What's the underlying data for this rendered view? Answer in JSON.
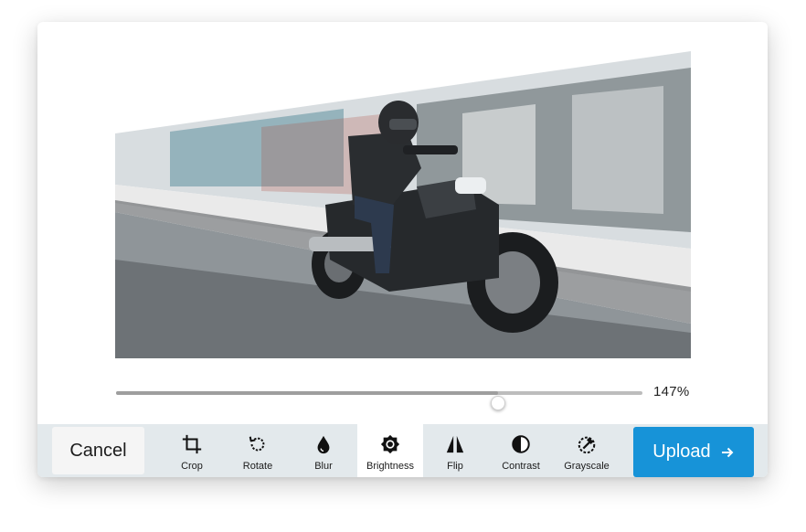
{
  "image": {
    "alt_hint": "motorcycle rider photo"
  },
  "zoom": {
    "value_text": "147%",
    "slider_fraction": 0.725
  },
  "toolbar": {
    "cancel_label": "Cancel",
    "upload_label": "Upload",
    "upload_icon": "arrow-right-icon",
    "accent_color": "#1793d8",
    "tools": [
      {
        "label": "Crop",
        "icon": "crop-icon",
        "active": false
      },
      {
        "label": "Rotate",
        "icon": "rotate-icon",
        "active": false
      },
      {
        "label": "Blur",
        "icon": "blur-drop-icon",
        "active": false
      },
      {
        "label": "Brightness",
        "icon": "brightness-icon",
        "active": true
      },
      {
        "label": "Flip",
        "icon": "flip-icon",
        "active": false
      },
      {
        "label": "Contrast",
        "icon": "contrast-icon",
        "active": false
      },
      {
        "label": "Grayscale",
        "icon": "grayscale-icon",
        "active": false
      }
    ]
  }
}
